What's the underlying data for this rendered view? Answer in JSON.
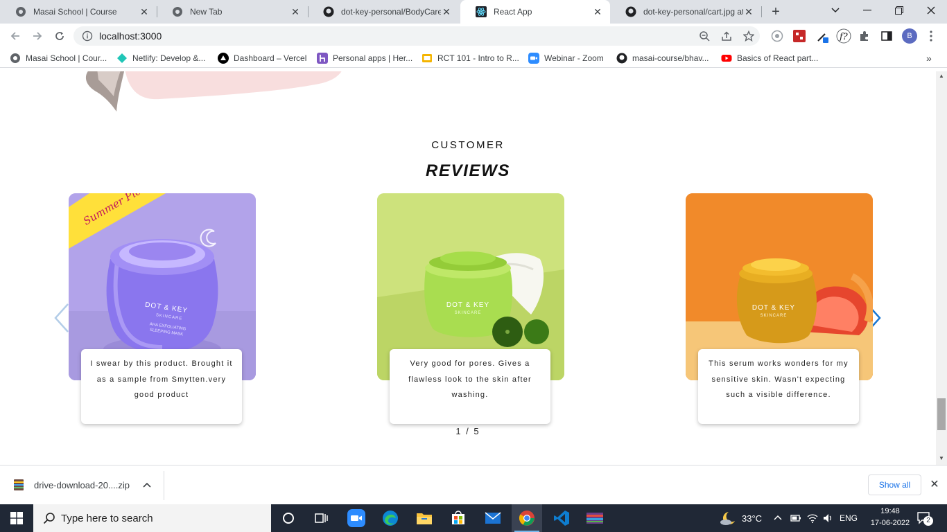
{
  "browser": {
    "tabs": [
      {
        "title": "Masai School | Course",
        "active": false
      },
      {
        "title": "New Tab",
        "active": false
      },
      {
        "title": "dot-key-personal/BodyCare.j",
        "active": false
      },
      {
        "title": "React App",
        "active": true
      },
      {
        "title": "dot-key-personal/cart.jpg at",
        "active": false
      }
    ],
    "url": "localhost:3000",
    "profile_initial": "B",
    "bookmarks": [
      "Masai School | Cour...",
      "Netlify: Develop &...",
      "Dashboard – Vercel",
      "Personal apps | Her...",
      "RCT 101 - Intro to R...",
      "Webinar - Zoom",
      "masai-course/bhav...",
      "Basics of React part..."
    ]
  },
  "page": {
    "heading_small": "CUSTOMER",
    "heading_big": "REVIEWS",
    "cards": [
      {
        "badge": "Summer Picks",
        "brand": "DOT & KEY",
        "product_lines": [
          "SKINCARE",
          "AHA EXFOLIATING",
          "SLEEPING MASK"
        ],
        "review": "I swear by this product. Brought it as a sample from Smytten.very good product",
        "bg": "#b3a6e9"
      },
      {
        "brand": "DOT & KEY",
        "product_lines": [
          "SKINCARE"
        ],
        "review": "Very good for pores. Gives a flawless look to the skin after washing.",
        "bg": "#c9e07a"
      },
      {
        "brand": "DOT & KEY",
        "product_lines": [
          "SKINCARE"
        ],
        "review": "This serum works wonders for my sensitive skin. Wasn't expecting such a visible difference.",
        "bg": "#f08a2a"
      }
    ],
    "pager": "1 / 5",
    "accent": "#1976d2"
  },
  "downloads": {
    "file": "drive-download-20....zip",
    "show_all": "Show all"
  },
  "taskbar": {
    "search_placeholder": "Type here to search",
    "temperature": "33°C",
    "language": "ENG",
    "time": "19:48",
    "date": "17-06-2022",
    "notifications": "2"
  }
}
